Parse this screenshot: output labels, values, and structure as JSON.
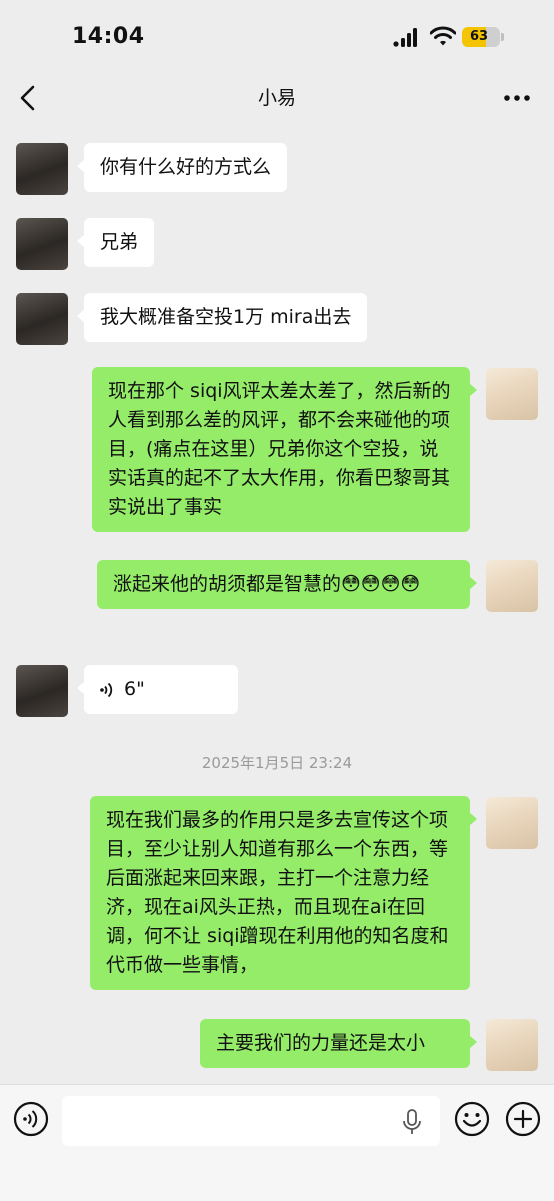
{
  "status": {
    "time": "14:04",
    "battery": "63",
    "battery_level": 0.63
  },
  "nav": {
    "title": "小易"
  },
  "messages": [
    {
      "side": "left",
      "text": "你有什么好的方式么"
    },
    {
      "side": "left",
      "text": "兄弟"
    },
    {
      "side": "left",
      "text": "我大概准备空投1万 mira出去"
    },
    {
      "side": "right",
      "text": "现在那个 siqi风评太差太差了，然后新的人看到那么差的风评，都不会来碰他的项目，(痛点在这里）兄弟你这个空投，说实话真的起不了太大作用，你看巴黎哥其实说出了事实"
    },
    {
      "side": "right",
      "text": "涨起来他的胡须都是智慧的😳😳😳😳"
    },
    {
      "side": "left",
      "type": "voice",
      "text": "6\""
    },
    {
      "type": "timestamp",
      "text": "2025年1月5日 23:24"
    },
    {
      "side": "right",
      "text": "现在我们最多的作用只是多去宣传这个项目，至少让别人知道有那么一个东西，等后面涨起来回来跟，主打一个注意力经济，现在ai风头正热，而且现在ai在回调，何不让 siqi蹭现在利用他的知名度和代币做一些事情，"
    },
    {
      "side": "right",
      "text": "主要我们的力量还是太小"
    }
  ],
  "input": {
    "value": "",
    "placeholder": ""
  },
  "icons": {
    "back": "chevron-left-icon",
    "more": "more-dots-icon",
    "voice_toggle": "voice-toggle-icon",
    "mic": "microphone-icon",
    "emoji": "emoji-icon",
    "plus": "plus-icon"
  },
  "colors": {
    "background": "#ededed",
    "outgoing_bubble": "#95ec69",
    "incoming_bubble": "#ffffff",
    "battery": "#f5c400"
  }
}
